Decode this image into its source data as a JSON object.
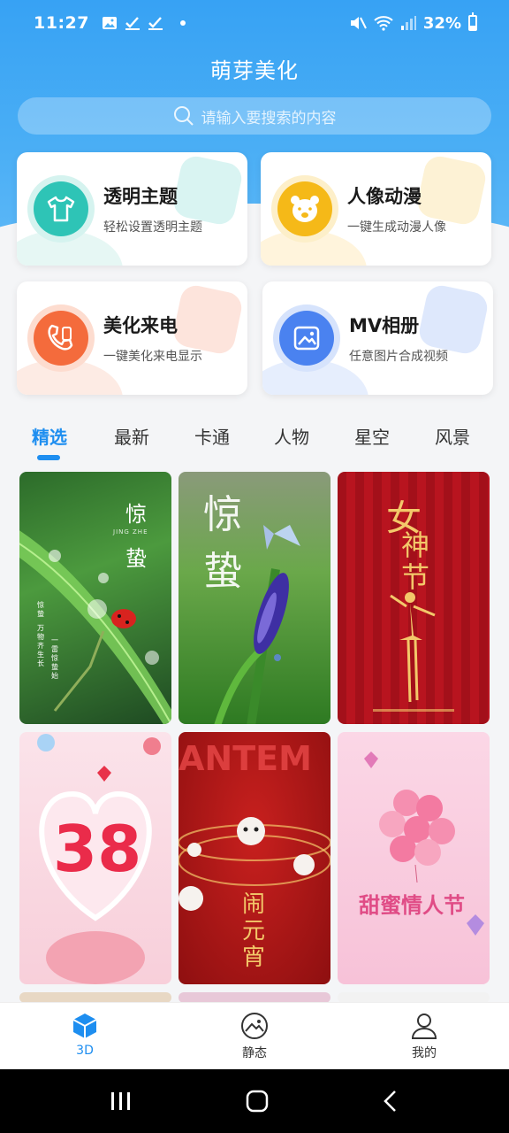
{
  "status": {
    "time": "11:27",
    "battery": "32%",
    "battery_level": 0.32
  },
  "header": {
    "title": "萌芽美化"
  },
  "search": {
    "placeholder": "请输入要搜索的内容"
  },
  "features": [
    {
      "title": "透明主题",
      "subtitle": "轻松设置透明主题",
      "icon": "tshirt-icon",
      "color": "#2ec4b6"
    },
    {
      "title": "人像动漫",
      "subtitle": "一键生成动漫人像",
      "icon": "bear-icon",
      "color": "#f5b918"
    },
    {
      "title": "美化来电",
      "subtitle": "一键美化来电显示",
      "icon": "phone-call-icon",
      "color": "#f46b3c"
    },
    {
      "title": "MV相册",
      "subtitle": "任意图片合成视频",
      "icon": "photo-album-icon",
      "color": "#4a82f0"
    }
  ],
  "tabs": [
    {
      "label": "精选",
      "active": true
    },
    {
      "label": "最新"
    },
    {
      "label": "卡通"
    },
    {
      "label": "人物"
    },
    {
      "label": "星空"
    },
    {
      "label": "风景"
    }
  ],
  "wallpapers": {
    "t1": {
      "title_a": "惊",
      "title_b": "蛰",
      "subtitle": "JING ZHE",
      "v1": "惊蛰",
      "v2": "万物齐生长",
      "v3": "一雷惊蛰始"
    },
    "t2": {
      "title_a": "惊",
      "title_b": "蛰"
    },
    "t3": {
      "title_a": "女",
      "title_b": "神",
      "title_c": "节"
    },
    "t4": {
      "number": "38"
    },
    "t5": {
      "text": "ANTEM",
      "title": "闹元宵"
    },
    "t6": {
      "title": "甜蜜情人节"
    }
  },
  "bottom_nav": [
    {
      "label": "3D",
      "icon": "cube-icon",
      "active": true
    },
    {
      "label": "静态",
      "icon": "image-icon"
    },
    {
      "label": "我的",
      "icon": "user-icon"
    }
  ],
  "colors": {
    "accent": "#1e8ef0",
    "header": "#37a2f4"
  }
}
